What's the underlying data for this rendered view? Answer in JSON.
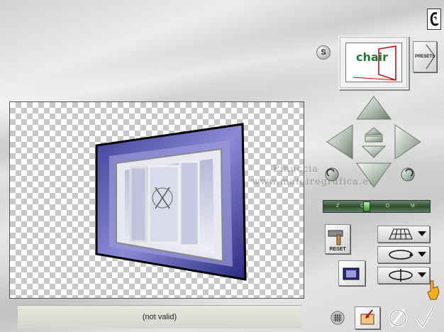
{
  "preview": {
    "title_text": "chair"
  },
  "presets": {
    "label": "PRESETS"
  },
  "settings_button": {
    "label": "S"
  },
  "watermark": {
    "line1": "Pinuccia",
    "line2": "www.maidiregrafica.eu"
  },
  "zoom": {
    "ticks": "Z O O M",
    "level": 0.4
  },
  "reset": {
    "label": "RESET"
  },
  "status": {
    "text": "(not valid)"
  },
  "colors": {
    "accent_green": "#2f8a2f",
    "window_frame": "#4a4aa0",
    "button_silver": "#cfd6cf"
  },
  "icons": [
    "logo-icon",
    "settings-icon",
    "arrow-up-icon",
    "arrow-down-icon",
    "arrow-left-icon",
    "arrow-right-icon",
    "move-up-icon",
    "move-down-icon",
    "rotate-left-icon",
    "rotate-right-icon",
    "perspective-grid-icon",
    "rotate-ellipse-icon",
    "rotate-axis-icon",
    "hammer-icon",
    "image-thumbnail-icon",
    "hand-pointer-icon",
    "grid-icon",
    "import-icon",
    "cancel-icon",
    "ok-check-icon"
  ]
}
